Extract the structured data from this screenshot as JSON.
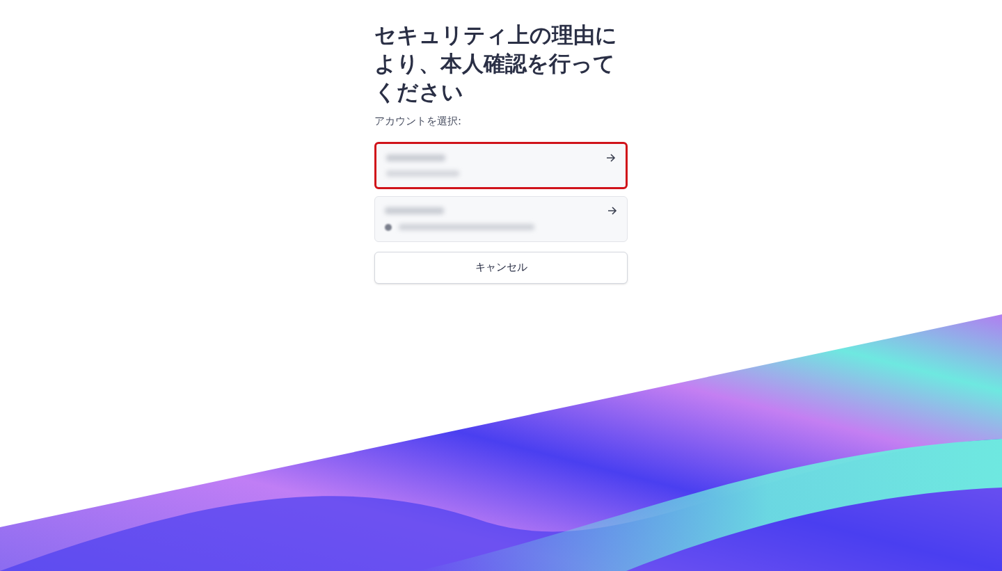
{
  "title": "セキュリティ上の理由により、本人確認を行ってください",
  "prompt": "アカウントを選択:",
  "accounts": [
    {
      "selected": true,
      "kind": "plain"
    },
    {
      "selected": false,
      "kind": "with-icon"
    }
  ],
  "cancel_button": "キャンセル"
}
